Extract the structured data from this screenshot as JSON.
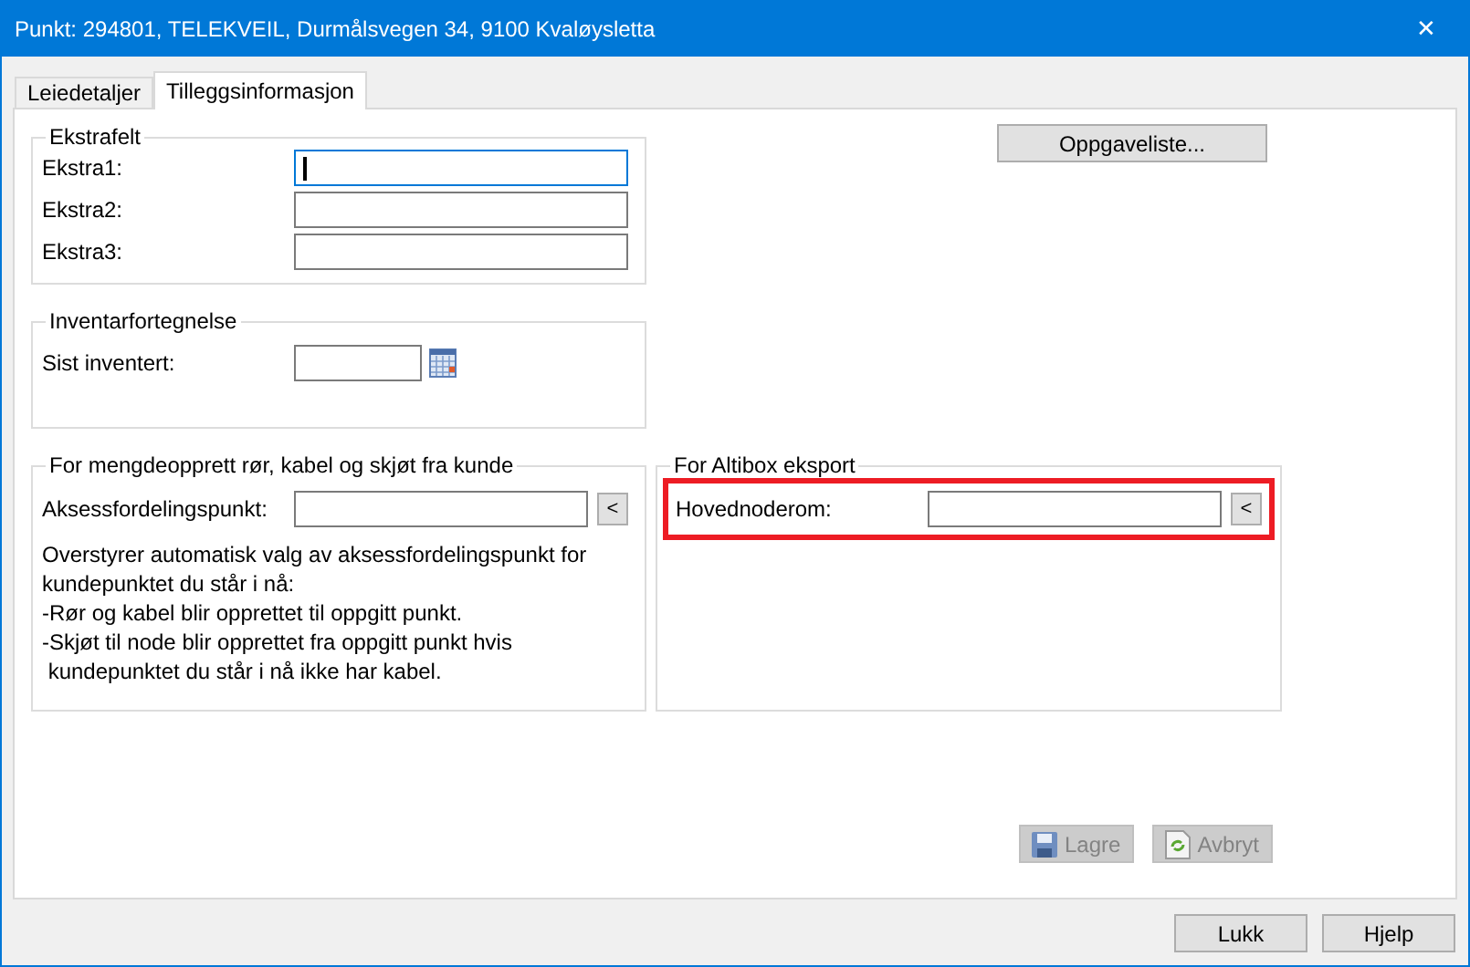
{
  "window": {
    "title": "Punkt: 294801, TELEKVEIL, Durmålsvegen 34, 9100 Kvaløysletta",
    "close": "✕"
  },
  "tabs": [
    {
      "label": "Leiedetaljer",
      "selected": false
    },
    {
      "label": "Tilleggsinformasjon",
      "selected": true
    }
  ],
  "ekstrafelt": {
    "title": "Ekstrafelt",
    "fields": [
      {
        "label": "Ekstra1:",
        "focused": true
      },
      {
        "label": "Ekstra2:",
        "focused": false
      },
      {
        "label": "Ekstra3:",
        "focused": false
      }
    ]
  },
  "task_button": {
    "label": "Oppgaveliste..."
  },
  "inventar": {
    "title": "Inventarfortegnelse",
    "field": {
      "label": "Sist inventert:"
    }
  },
  "mengde": {
    "title": "For mengdeopprett rør, kabel og skjøt fra kunde",
    "field": {
      "label": "Aksessfordelingspunkt:",
      "button": "<",
      "highlighted": false
    },
    "help_lines": [
      "Overstyrer automatisk valg av aksessfordelingspunkt for",
      "kundepunktet du står i nå:",
      "-Rør og kabel blir opprettet til oppgitt punkt.",
      "-Skjøt til node blir opprettet fra oppgitt punkt hvis",
      " kundepunktet du står i nå ikke har kabel."
    ]
  },
  "altibox": {
    "title": "For Altibox eksport",
    "field": {
      "label": "Hovednoderom:",
      "button": "<",
      "highlighted": true
    }
  },
  "action_buttons": [
    {
      "label": "Lagre",
      "kind": "save",
      "disabled": true
    },
    {
      "label": "Avbryt",
      "kind": "cancel",
      "disabled": true
    }
  ],
  "footer_buttons": [
    {
      "label": "Lukk"
    },
    {
      "label": "Hjelp"
    }
  ]
}
